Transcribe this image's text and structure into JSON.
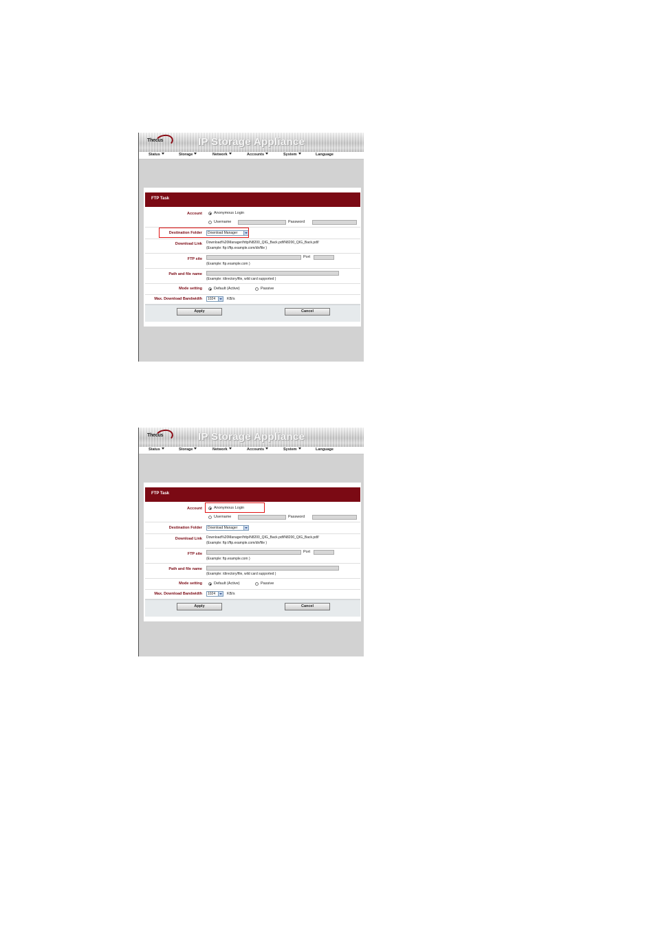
{
  "screens": [
    {
      "app": {
        "logo": "Thecus",
        "title": "IP Storage Appliance"
      },
      "menu": [
        "Status",
        "Storage",
        "Network",
        "Accounts",
        "System",
        "Language"
      ],
      "panel_title": "FTP Task",
      "form": {
        "account_label": "Account",
        "anonymous_login": "Anonymous Login",
        "username_label": "Username",
        "password_label": "Password",
        "destination_label": "Destination Folder",
        "destination_value": "Download Manager",
        "download_link_label": "Download Link",
        "download_link_value": "Download%20Manager/http/N8200_QIG_Back.pdf/N8200_QIG_Back.pdf/",
        "download_link_hint": "(Example: ftp://ftp.example.com/dir/file )",
        "ftp_site_label": "FTP site",
        "port_label": "Port",
        "ftp_site_hint": "(Example: ftp.example.com )",
        "path_label": "Path and file name",
        "path_hint": "(Example: /directory/file, wild card supported )",
        "mode_label": "Mode setting",
        "mode_default": "Default (Active)",
        "mode_passive": "Passive",
        "bandwidth_label": "Max. Download Bandwidth",
        "bandwidth_value": "1024",
        "bandwidth_unit": "KB/s"
      },
      "buttons": {
        "apply": "Apply",
        "cancel": "Cancel"
      },
      "highlight_color": "#e01010"
    },
    {
      "app": {
        "logo": "Thecus",
        "title": "IP Storage Appliance"
      },
      "menu": [
        "Status",
        "Storage",
        "Network",
        "Accounts",
        "System",
        "Language"
      ],
      "panel_title": "FTP Task",
      "form": {
        "account_label": "Account",
        "anonymous_login": "Anonymous Login",
        "username_label": "Username",
        "password_label": "Password",
        "destination_label": "Destination Folder",
        "destination_value": "Download Manager",
        "download_link_label": "Download Link",
        "download_link_value": "Download%20Manager/http/N8200_QIG_Back.pdf/N8200_QIG_Back.pdf/",
        "download_link_hint": "(Example: ftp://ftp.example.com/dir/file )",
        "ftp_site_label": "FTP site",
        "port_label": "Port",
        "ftp_site_hint": "(Example: ftp.example.com )",
        "path_label": "Path and file name",
        "path_hint": "(Example: /directory/file, wild card supported )",
        "mode_label": "Mode setting",
        "mode_default": "Default (Active)",
        "mode_passive": "Passive",
        "bandwidth_label": "Max. Download Bandwidth",
        "bandwidth_value": "1024",
        "bandwidth_unit": "KB/s"
      },
      "buttons": {
        "apply": "Apply",
        "cancel": "Cancel"
      },
      "highlight_color": "#e01010"
    }
  ]
}
